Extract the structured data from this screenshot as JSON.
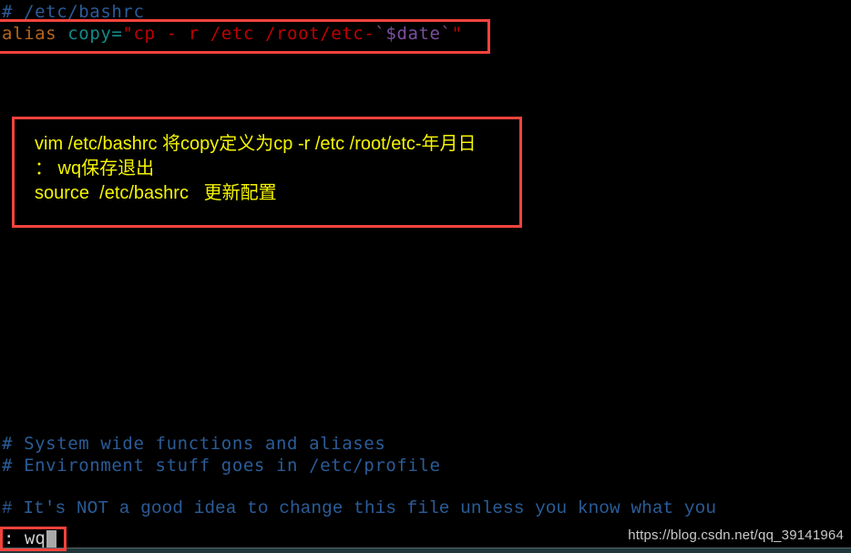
{
  "window": {
    "title": "vim /etc/bashrc",
    "background_color": "#000000"
  },
  "editor": {
    "lines": {
      "comment_bashrc": "# /etc/bashrc",
      "alias": {
        "keyword": "alias",
        "space1": " ",
        "name": "copy",
        "equals": "=",
        "quote_open": "\"",
        "command": "cp - r /etc /root/etc-",
        "backtick_open": "`",
        "variable": "$date",
        "backtick_close": "`",
        "quote_close": "\""
      },
      "comment_system": "# System wide functions and aliases",
      "comment_environment": "# Environment stuff goes in /etc/profile",
      "comment_not": "# It's NOT a good idea to change this file unless you know what you"
    },
    "colors": {
      "comment": "#2b5c98",
      "alias_keyword": "#b5651d",
      "alias_name": "#128b8b",
      "string": "#c00000",
      "subshell_variable": "#7c4fa0",
      "backtick": "#8a4a7a"
    }
  },
  "status": {
    "command": ": wq",
    "cursor": "block-cursor"
  },
  "annotations": {
    "accent_color": "#f4433c",
    "note_text_color": "#f5f500",
    "alias_highlight_label": "alias-line-highlight",
    "status_highlight_label": "status-line-highlight",
    "note": {
      "line1": "vim /etc/bashrc 将copy定义为cp -r /etc /root/etc-年月日",
      "line2": "： wq保存退出",
      "line3": "source  /etc/bashrc   更新配置"
    }
  },
  "watermark": {
    "text": "https://blog.csdn.net/qq_39141964"
  }
}
